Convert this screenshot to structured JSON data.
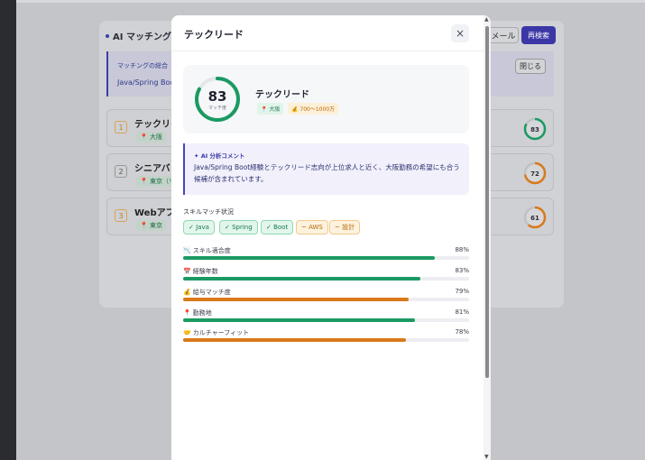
{
  "background": {
    "panel_title": "AI マッチング",
    "mail_button": "メール",
    "research_button": "再検索",
    "banner_line1": "マッチングの総合",
    "banner_line2": "Java/Spring Boo",
    "close_button": "閉じる",
    "rows": [
      {
        "rank": "1",
        "name": "テックリー",
        "tag": "📍 大阪",
        "score": 83,
        "color": "#1a9a62"
      },
      {
        "rank": "2",
        "name": "シニアバッ",
        "tag": "📍 東京（リ",
        "score": 72,
        "color": "#d9791a"
      },
      {
        "rank": "3",
        "name": "Webアプリ",
        "tag": "📍 東京",
        "score": 61,
        "color": "#d9791a"
      }
    ]
  },
  "modal": {
    "title": "テックリード",
    "close_icon": "×",
    "summary": {
      "score": 83,
      "score_label": "マッチ度",
      "job_title": "テックリード",
      "location": "📍 大阪",
      "salary": "💰 700〜1000万",
      "ring_color": "#1a9a62"
    },
    "ai_comment": {
      "title": "✦ AI 分析コメント",
      "text": "Java/Spring Boot経験とテックリード志向が上位求人と近く、大阪勤務の希望にも合う候補が含まれています。"
    },
    "skills_heading": "スキルマッチ状況",
    "skills": [
      {
        "label": "✓ Java",
        "status": "ok"
      },
      {
        "label": "✓ Spring",
        "status": "ok"
      },
      {
        "label": "✓ Boot",
        "status": "ok"
      },
      {
        "label": "~ AWS",
        "status": "warn"
      },
      {
        "label": "~ 設計",
        "status": "warn"
      }
    ],
    "metrics": [
      {
        "icon": "📉",
        "label": "スキル適合度",
        "value": 88,
        "pct": "88%",
        "color": "#1a9a62"
      },
      {
        "icon": "📅",
        "label": "経験年数",
        "value": 83,
        "pct": "83%",
        "color": "#1a9a62"
      },
      {
        "icon": "💰",
        "label": "給与マッチ度",
        "value": 79,
        "pct": "79%",
        "color": "#d9791a"
      },
      {
        "icon": "📍",
        "label": "勤務地",
        "value": 81,
        "pct": "81%",
        "color": "#1a9a62"
      },
      {
        "icon": "🤝",
        "label": "カルチャーフィット",
        "value": 78,
        "pct": "78%",
        "color": "#d9791a"
      }
    ]
  }
}
